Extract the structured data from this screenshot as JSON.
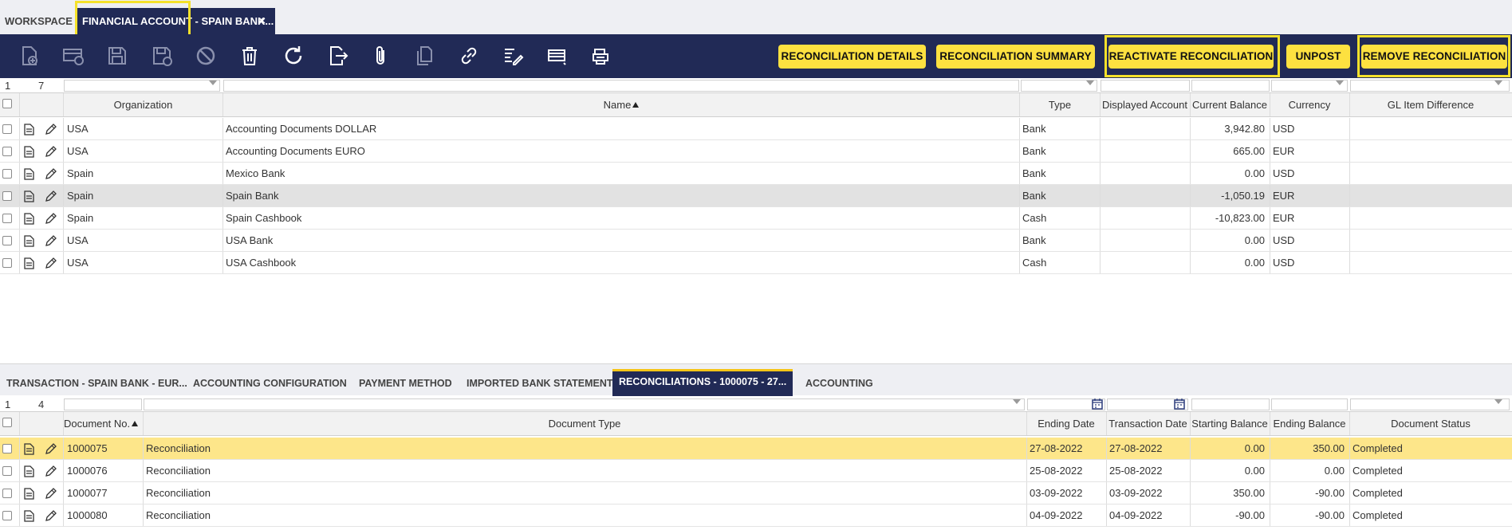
{
  "top_tabs": {
    "workspace": "WORKSPACE",
    "active": "FINANCIAL ACCOUNT - SPAIN BANK...",
    "close": "×"
  },
  "toolbar": {
    "icons": [
      "new-document-icon",
      "new-row-icon",
      "save-icon",
      "save-close-icon",
      "undo-icon",
      "delete-icon",
      "refresh-icon",
      "export-icon",
      "attachment-icon",
      "copy-record-icon",
      "link-icon",
      "audit-icon",
      "grid-view-icon",
      "print-icon"
    ],
    "buttons": {
      "reconciliation_details": "RECONCILIATION DETAILS",
      "reconciliation_summary": "RECONCILIATION SUMMARY",
      "reactivate_reconciliation": "REACTIVATE RECONCILIATION",
      "unpost": "UNPOST",
      "remove_reconciliation": "REMOVE RECONCILIATION"
    }
  },
  "top_grid": {
    "selected_index": "1",
    "total_count": "7",
    "columns": {
      "organization": "Organization",
      "name": "Name",
      "type": "Type",
      "displayed_account": "Displayed Account",
      "current_balance": "Current Balance",
      "currency": "Currency",
      "gl_item_difference": "GL Item Difference"
    },
    "rows": [
      {
        "organization": "USA",
        "name": "Accounting Documents DOLLAR",
        "type": "Bank",
        "displayed_account": "",
        "current_balance": "3,942.80",
        "currency": "USD",
        "gl_item_difference": ""
      },
      {
        "organization": "USA",
        "name": "Accounting Documents EURO",
        "type": "Bank",
        "displayed_account": "",
        "current_balance": "665.00",
        "currency": "EUR",
        "gl_item_difference": ""
      },
      {
        "organization": "Spain",
        "name": "Mexico Bank",
        "type": "Bank",
        "displayed_account": "",
        "current_balance": "0.00",
        "currency": "USD",
        "gl_item_difference": ""
      },
      {
        "organization": "Spain",
        "name": "Spain Bank",
        "type": "Bank",
        "displayed_account": "",
        "current_balance": "-1,050.19",
        "currency": "EUR",
        "gl_item_difference": ""
      },
      {
        "organization": "Spain",
        "name": "Spain Cashbook",
        "type": "Cash",
        "displayed_account": "",
        "current_balance": "-10,823.00",
        "currency": "EUR",
        "gl_item_difference": ""
      },
      {
        "organization": "USA",
        "name": "USA Bank",
        "type": "Bank",
        "displayed_account": "",
        "current_balance": "0.00",
        "currency": "USD",
        "gl_item_difference": ""
      },
      {
        "organization": "USA",
        "name": "USA Cashbook",
        "type": "Cash",
        "displayed_account": "",
        "current_balance": "0.00",
        "currency": "USD",
        "gl_item_difference": ""
      }
    ]
  },
  "sub_tabs": [
    {
      "label": "TRANSACTION - SPAIN BANK - EUR..."
    },
    {
      "label": "ACCOUNTING CONFIGURATION"
    },
    {
      "label": "PAYMENT METHOD"
    },
    {
      "label": "IMPORTED BANK STATEMENTS"
    },
    {
      "label": "RECONCILIATIONS - 1000075 - 27..."
    },
    {
      "label": "ACCOUNTING"
    }
  ],
  "bottom_grid": {
    "selected_index": "1",
    "total_count": "4",
    "columns": {
      "document_no": "Document No.",
      "document_type": "Document Type",
      "ending_date": "Ending Date",
      "transaction_date": "Transaction Date",
      "starting_balance": "Starting Balance",
      "ending_balance": "Ending Balance",
      "document_status": "Document Status"
    },
    "rows": [
      {
        "document_no": "1000075",
        "document_type": "Reconciliation",
        "ending_date": "27-08-2022",
        "transaction_date": "27-08-2022",
        "starting_balance": "0.00",
        "ending_balance": "350.00",
        "document_status": "Completed"
      },
      {
        "document_no": "1000076",
        "document_type": "Reconciliation",
        "ending_date": "25-08-2022",
        "transaction_date": "25-08-2022",
        "starting_balance": "0.00",
        "ending_balance": "0.00",
        "document_status": "Completed"
      },
      {
        "document_no": "1000077",
        "document_type": "Reconciliation",
        "ending_date": "03-09-2022",
        "transaction_date": "03-09-2022",
        "starting_balance": "350.00",
        "ending_balance": "-90.00",
        "document_status": "Completed"
      },
      {
        "document_no": "1000080",
        "document_type": "Reconciliation",
        "ending_date": "04-09-2022",
        "transaction_date": "04-09-2022",
        "starting_balance": "-90.00",
        "ending_balance": "-90.00",
        "document_status": "Completed"
      }
    ]
  },
  "colors": {
    "navy": "#212a56",
    "button_yellow": "#fde140",
    "highlight_border": "#f5e12a",
    "selected_row": "#fde68a",
    "grey_row": "#e2e2e2"
  }
}
